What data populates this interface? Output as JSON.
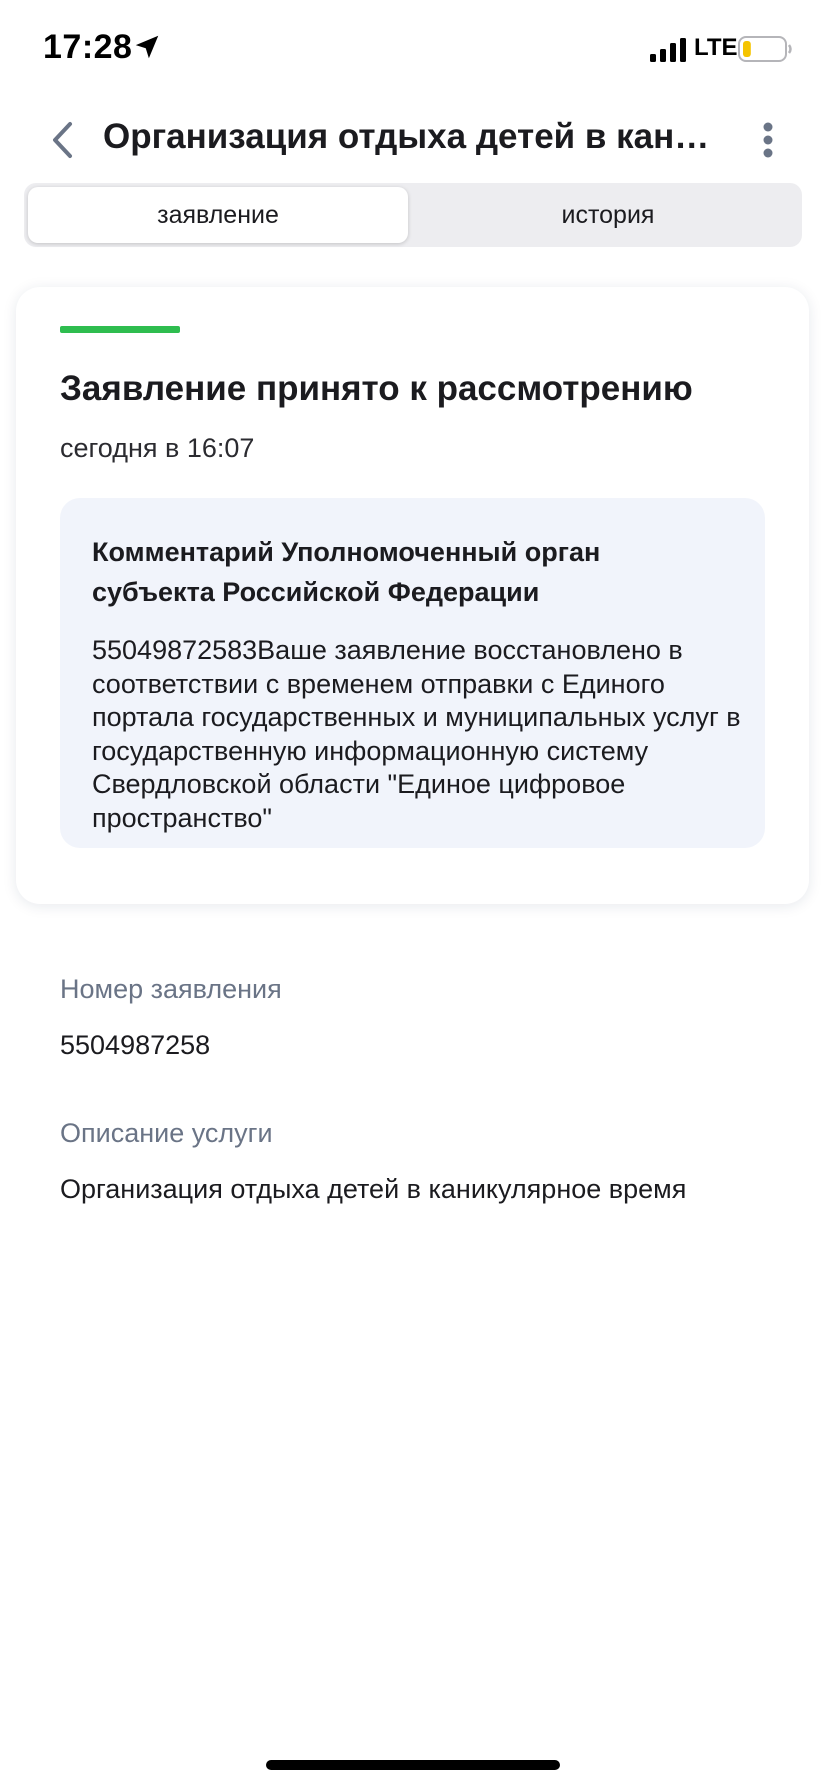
{
  "status_bar": {
    "time": "17:28",
    "network": "LTE",
    "location_icon": "location-arrow-icon",
    "signal_icon": "signal-bars-icon",
    "battery_icon": "battery-low-icon",
    "battery_level": 0.2,
    "battery_color": "#f5c400"
  },
  "header": {
    "title": "Организация отдыха детей в каникулярное время",
    "back_icon": "chevron-left-icon",
    "more_icon": "more-vertical-icon",
    "icon_color": "#6a7486"
  },
  "tabs": [
    {
      "label": "заявление",
      "active": true
    },
    {
      "label": "история",
      "active": false
    }
  ],
  "status_card": {
    "accent_color": "#2ebd4f",
    "heading": "Заявление принято к рассмотрению",
    "time": "сегодня в 16:07",
    "comment": {
      "title": "Комментарий Уполномоченный орган субъекта Российской Федерации",
      "text": "55049872583Ваше заявление восстановлено в соответствии с временем отправки с Единого портала государственных и муниципальных услуг в государственную информационную систему Свердловской области \"Единое цифровое пространство\""
    }
  },
  "details": [
    {
      "label": "Номер заявления",
      "value": "5504987258"
    },
    {
      "label": "Описание услуги",
      "value": "Организация отдыха детей в каникулярное время"
    }
  ]
}
